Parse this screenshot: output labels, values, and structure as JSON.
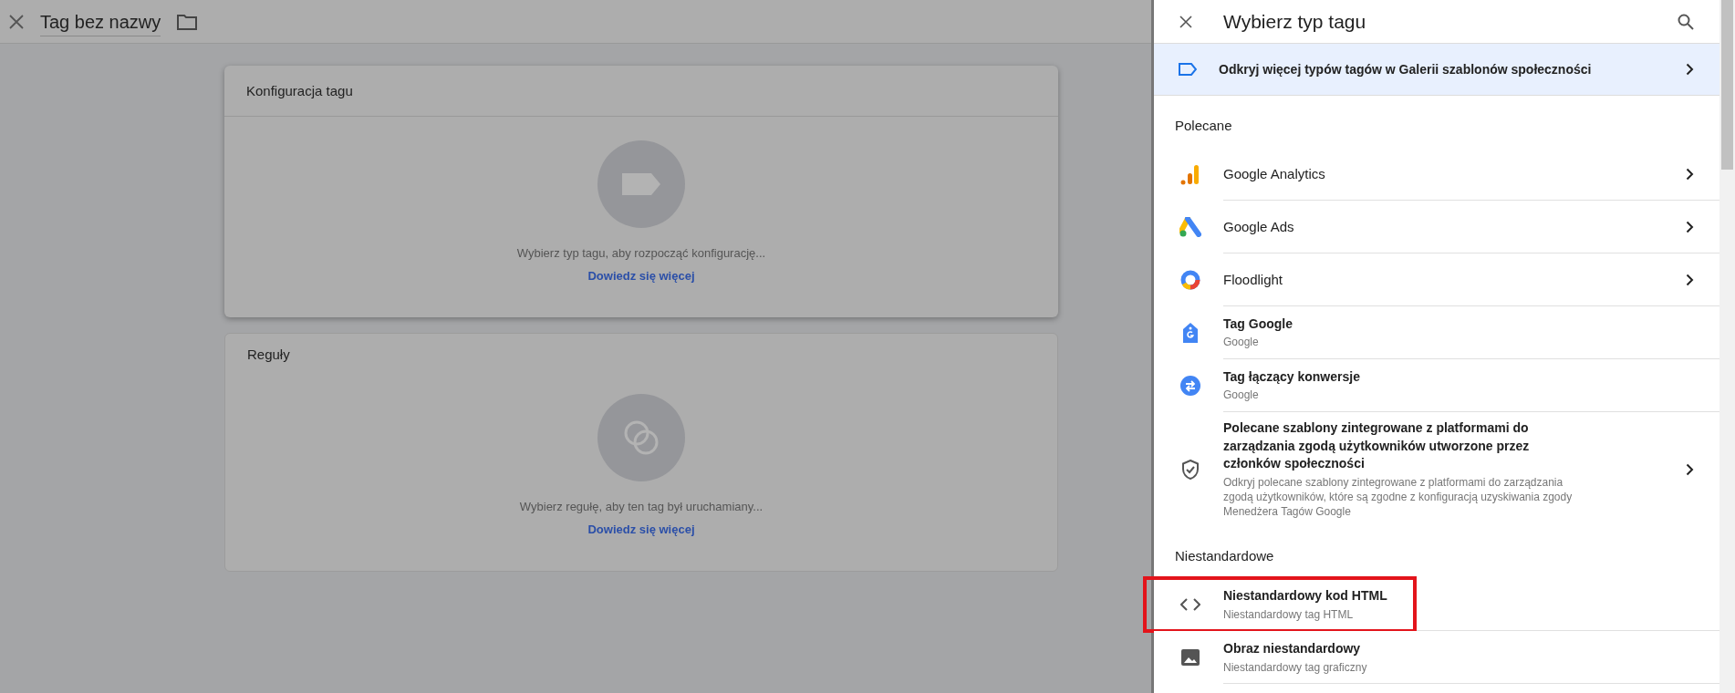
{
  "page_header": {
    "title": "Tag bez nazwy"
  },
  "cards": [
    {
      "kind": "tag",
      "title": "Konfiguracja tagu",
      "hint": "Wybierz typ tagu, aby rozpocząć konfigurację...",
      "link": "Dowiedz się więcej"
    },
    {
      "kind": "trigger",
      "title": "Reguły",
      "hint": "Wybierz regułę, aby ten tag był uruchamiany...",
      "link": "Dowiedz się więcej"
    }
  ],
  "panel": {
    "title": "Wybierz typ tagu",
    "banner": "Odkryj więcej typów tagów w Galerii szablonów społeczności",
    "sections": [
      {
        "heading": "Polecane",
        "items": [
          {
            "kind": "analytics",
            "name": "Google Analytics",
            "chevron": true,
            "highlighted": false
          },
          {
            "kind": "ads",
            "name": "Google Ads",
            "chevron": true,
            "highlighted": false
          },
          {
            "kind": "floodlight",
            "name": "Floodlight",
            "chevron": true,
            "highlighted": false
          },
          {
            "kind": "gtag",
            "name": "Tag Google",
            "subtitle": "Google",
            "chevron": false,
            "highlighted": false
          },
          {
            "kind": "linker",
            "name": "Tag łączący konwersje",
            "subtitle": "Google",
            "chevron": false,
            "highlighted": false
          },
          {
            "kind": "shield",
            "name": "Polecane szablony zintegrowane z platformami do zarządzania zgodą użytkowników utworzone przez członków społeczności",
            "subtitle": "Odkryj polecane szablony zintegrowane z platformami do zarządzania zgodą użytkowników, które są zgodne z konfiguracją uzyskiwania zgody Menedżera Tagów Google",
            "chevron": true,
            "highlighted": false
          }
        ]
      },
      {
        "heading": "Niestandardowe",
        "items": [
          {
            "kind": "code",
            "name": "Niestandardowy kod HTML",
            "subtitle": "Niestandardowy tag HTML",
            "chevron": false,
            "highlighted": true
          },
          {
            "kind": "image",
            "name": "Obraz niestandardowy",
            "subtitle": "Niestandardowy tag graficzny",
            "chevron": false,
            "highlighted": false
          }
        ]
      }
    ]
  }
}
